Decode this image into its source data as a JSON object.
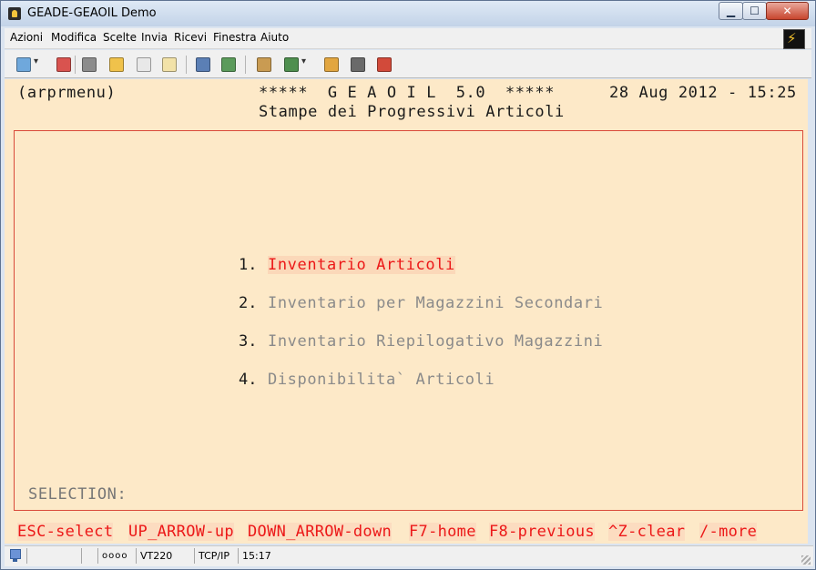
{
  "window": {
    "title": "GEADE-GEAOIL Demo",
    "controls": {
      "minimize": "▁",
      "maximize": "☐",
      "close": "✕"
    }
  },
  "menubar": {
    "items": [
      {
        "label": "Azioni"
      },
      {
        "label": "Modifica"
      },
      {
        "label": "Scelte"
      },
      {
        "label": "Invia"
      },
      {
        "label": "Ricevi"
      },
      {
        "label": "Finestra"
      },
      {
        "label": "Aiuto"
      }
    ]
  },
  "toolbar": {
    "icons": [
      "new-session-icon",
      "disconnect-icon",
      "print-icon",
      "open-folder-icon",
      "copy-icon",
      "paste-icon",
      "send-file-icon",
      "receive-file-icon",
      "book-icon",
      "font-icon",
      "properties-icon",
      "settings-icon",
      "screen-capture-icon"
    ]
  },
  "terminal": {
    "header_left": "(arprmenu)",
    "header_center": "*****  G E A O I L  5.0  *****",
    "header_right": "28 Aug 2012 - 15:25",
    "subtitle": "Stampe dei Progressivi Articoli",
    "menu": [
      {
        "number": "1.",
        "label": "Inventario Articoli",
        "selected": true
      },
      {
        "number": "2.",
        "label": "Inventario per Magazzini Secondari",
        "selected": false
      },
      {
        "number": "3.",
        "label": "Inventario Riepilogativo Magazzini",
        "selected": false
      },
      {
        "number": "4.",
        "label": "Disponibilita` Articoli",
        "selected": false
      }
    ],
    "selection_prompt": "SELECTION:",
    "function_keys": [
      "ESC-select",
      "UP_ARROW-up",
      "DOWN_ARROW-down",
      "F7-home",
      "F8-previous",
      "^Z-clear",
      "/-more"
    ]
  },
  "statusbar": {
    "indicators": "oooo",
    "emulation": "VT220",
    "protocol": "TCP/IP",
    "time": "15:17"
  },
  "colors": {
    "terminal_bg": "#fde9c8",
    "highlight": "#ec1818",
    "box_border": "#d94a3a",
    "dim_text": "#8a8a8a"
  }
}
